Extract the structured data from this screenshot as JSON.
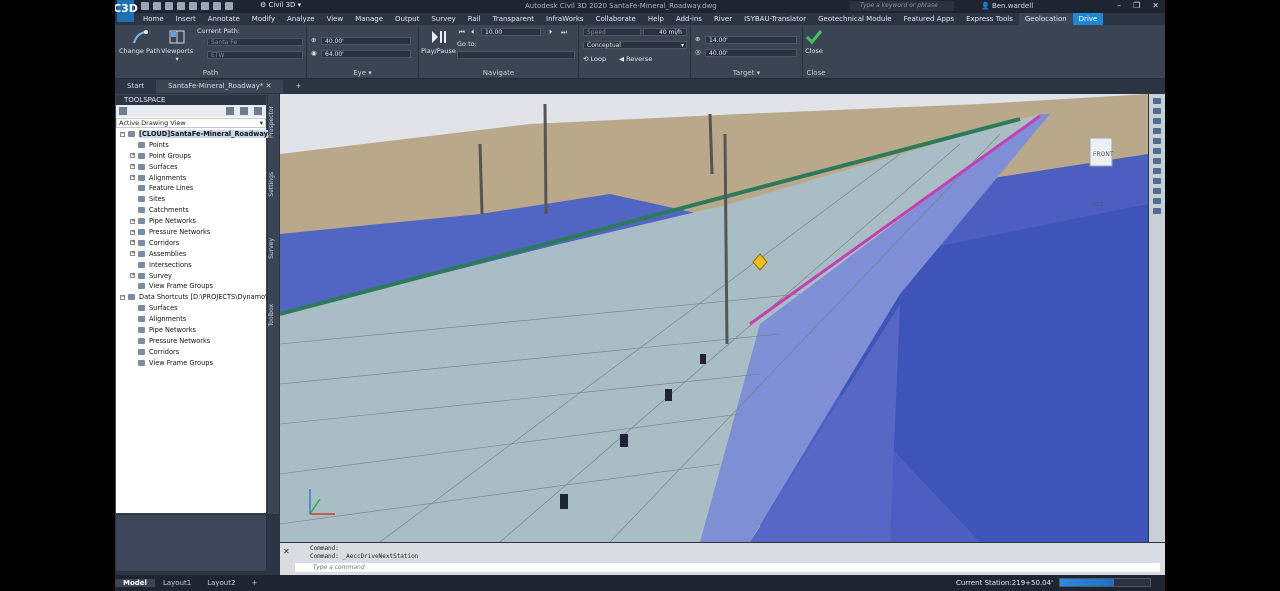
{
  "titlebar": {
    "workspace": "Civil 3D",
    "doc_title": "Autodesk Civil 3D 2020   SantaFe-Mineral_Roadway.dwg",
    "search_placeholder": "Type a keyword or phrase",
    "user": "Ben.wardell"
  },
  "app_logo": "C3D",
  "menu_tabs": [
    "Home",
    "Insert",
    "Annotate",
    "Modify",
    "Analyze",
    "View",
    "Manage",
    "Output",
    "Survey",
    "Rail",
    "Transparent",
    "InfraWorks",
    "Collaborate",
    "Help",
    "Add-ins",
    "River",
    "ISYBAU-Translator",
    "Geotechnical Module",
    "Featured Apps",
    "Express Tools",
    "Geolocation",
    "Drive"
  ],
  "ribbon": {
    "path": {
      "change_path": "Change Path",
      "viewports": "Viewports",
      "current_path_label": "Current Path:",
      "path_value": "Santa Fe",
      "path_sub": "ETW",
      "label": "Path"
    },
    "eye": {
      "height": "40.00'",
      "distance": "64.00'",
      "label": "Eye"
    },
    "navigate": {
      "play_pause": "Play/Pause",
      "step": "10.00",
      "goto_label": "Go to:",
      "label": "Navigate"
    },
    "drive": {
      "speed_placeholder": "Speed",
      "speed_value": "40 mi/h",
      "visual_style": "Conceptual",
      "loop": "Loop",
      "reverse": "Reverse"
    },
    "target": {
      "height": "14.00'",
      "distance": "40.00'",
      "label": "Target"
    },
    "close": {
      "button": "Close",
      "label": "Close"
    }
  },
  "doc_tabs": [
    "Start",
    "SantaFe-Mineral_Roadway*"
  ],
  "toolspace": {
    "title": "TOOLSPACE",
    "view": "Active Drawing View",
    "drawing": "[CLOUD]SantaFe-Mineral_Roadway",
    "items": [
      "Points",
      "Point Groups",
      "Surfaces",
      "Alignments",
      "Feature Lines",
      "Sites",
      "Catchments",
      "Pipe Networks",
      "Pressure Networks",
      "Corridors",
      "Assemblies",
      "Intersections",
      "Survey",
      "View Frame Groups"
    ],
    "shortcuts_root": "Data Shortcuts [D:\\PROJECTS\\Dynamo\\L...",
    "shortcuts": [
      "Surfaces",
      "Alignments",
      "Pipe Networks",
      "Pressure Networks",
      "Corridors",
      "View Frame Groups"
    ],
    "side_tabs": [
      "Prospector",
      "Settings",
      "Survey",
      "Toolbox"
    ]
  },
  "viewcube": {
    "face": "FRONT",
    "ucs": "WCS"
  },
  "command": {
    "history": [
      "Command:",
      "Command:  _AeccDriveNextStation"
    ],
    "placeholder": "Type a command"
  },
  "status": {
    "layout_tabs": [
      "Model",
      "Layout1",
      "Layout2"
    ],
    "station": "Current Station:219+50.04'",
    "progress": 0.6
  }
}
